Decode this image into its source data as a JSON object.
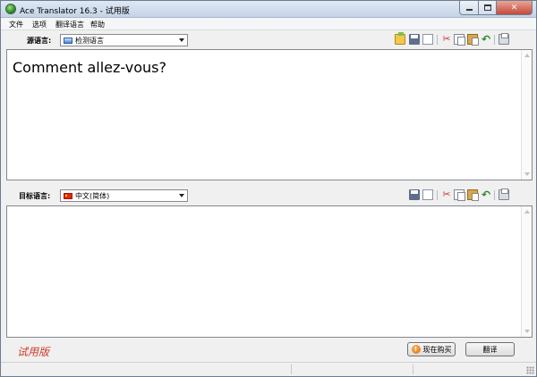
{
  "window": {
    "title": "Ace Translator 16.3 - 试用版",
    "controls": {
      "close": "✕"
    }
  },
  "menu": [
    "文件",
    "选项",
    "翻译语言",
    "帮助"
  ],
  "source": {
    "label": "源语言:",
    "selected": "检测语言",
    "text": "Comment allez-vous?"
  },
  "target": {
    "label": "目标语言:",
    "selected": "中文(简体)",
    "text": ""
  },
  "toolbar_icons": [
    "open-folder-icon",
    "save-icon",
    "new-document-icon",
    "cut-icon",
    "copy-icon",
    "paste-icon",
    "undo-icon",
    "print-icon"
  ],
  "footer": {
    "trial": "试用版",
    "buy_label": "现在购买",
    "buy_icon_glyph": "!",
    "translate_label": "翻译"
  },
  "colors": {
    "trial_text": "#d23c2a",
    "buy_icon": "#e06a00"
  }
}
